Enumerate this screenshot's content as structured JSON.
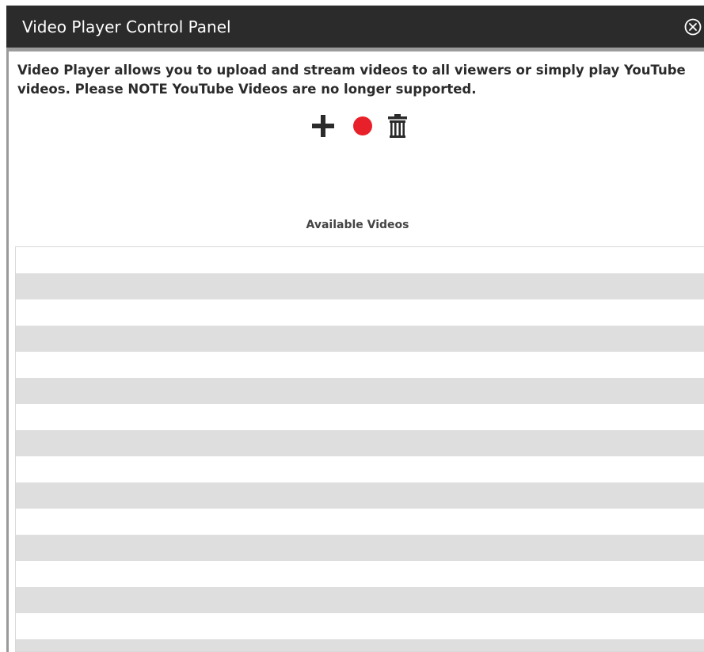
{
  "window": {
    "title": "Video Player Control Panel",
    "close_icon": "circle-x-icon"
  },
  "description": "Video Player allows you to upload and stream videos to all viewers or simply play YouTube videos. Please NOTE YouTube Videos are no longer supported.",
  "toolbar": {
    "add_icon": "plus-icon",
    "record_icon": "record-icon",
    "delete_icon": "trash-icon",
    "record_color": "#e8202a"
  },
  "video_list": {
    "heading": "Available Videos",
    "items": [],
    "stripe_color": "#dedede"
  }
}
